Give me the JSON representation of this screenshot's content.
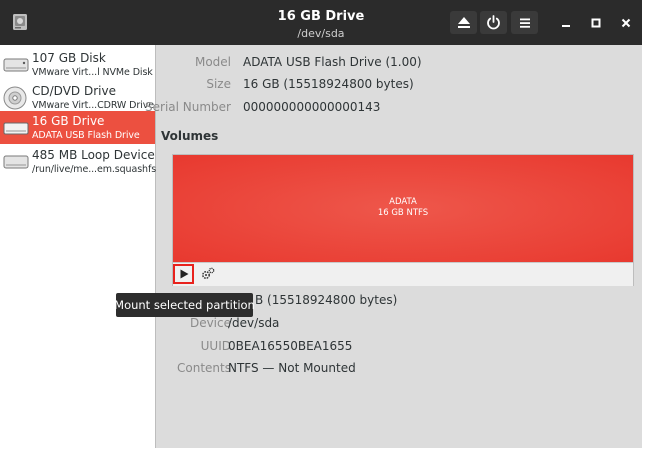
{
  "titlebar": {
    "title": "16 GB Drive",
    "subtitle": "/dev/sda",
    "app_icon": "disks-icon",
    "buttons": [
      "eject-icon",
      "power-icon",
      "menu-icon"
    ],
    "window_controls": [
      "minimize",
      "maximize",
      "close"
    ]
  },
  "sidebar": {
    "items": [
      {
        "name": "107 GB Disk",
        "sub": "VMware Virt...l NVMe Disk",
        "icon": "hard-disk-icon",
        "selected": false
      },
      {
        "name": "CD/DVD Drive",
        "sub": "VMware Virt...CDRW Drive",
        "icon": "optical-disc-icon",
        "selected": false
      },
      {
        "name": "16 GB Drive",
        "sub": "ADATA USB Flash Drive",
        "icon": "usb-drive-icon",
        "selected": true
      },
      {
        "name": "485 MB Loop Device",
        "sub": "/run/live/me...em.squashfs",
        "icon": "loop-device-icon",
        "selected": false
      }
    ]
  },
  "drive": {
    "model_label": "Model",
    "model": "ADATA USB Flash Drive (1.00)",
    "size_label": "Size",
    "size": "16 GB (15518924800 bytes)",
    "serial_label": "Serial Number",
    "serial": "000000000000000143"
  },
  "volumes": {
    "title": "Volumes",
    "partition_name": "ADATA",
    "partition_info": "16 GB NTFS",
    "partition_color": "#ec3c32"
  },
  "partition": {
    "size_partial": "B (15518924800 bytes)",
    "device_label": "Device",
    "device": "/dev/sda",
    "uuid_label": "UUID",
    "uuid": "0BEA16550BEA1655",
    "contents_label": "Contents",
    "contents": "NTFS — Not Mounted"
  },
  "tooltip": {
    "text": "Mount selected partition"
  },
  "colors": {
    "selection": "#ec5040",
    "highlight": "#e8221d",
    "titlebar": "#2b2b2b"
  }
}
